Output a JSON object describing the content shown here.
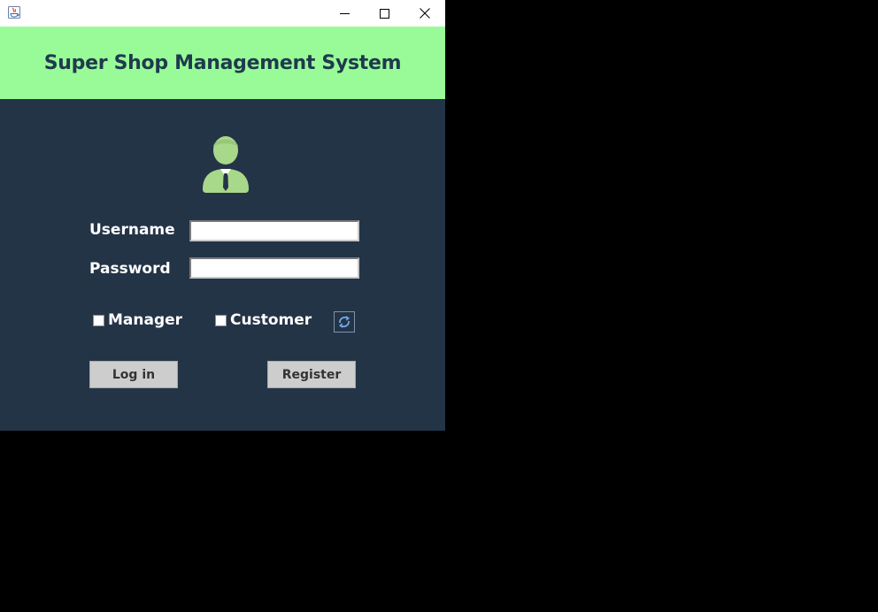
{
  "window": {
    "controls": {
      "minimize_icon": "minimize-icon",
      "maximize_icon": "maximize-icon",
      "close_icon": "close-icon"
    }
  },
  "header": {
    "title": "Super Shop Management System",
    "background": "#98fb98",
    "text_color": "#1f3a4d"
  },
  "form": {
    "background": "#243447",
    "avatar_icon": "user-avatar-icon",
    "username_label": "Username",
    "username_value": "",
    "password_label": "Password",
    "password_value": "",
    "manager_label": "Manager",
    "customer_label": "Customer",
    "refresh_icon": "refresh-icon",
    "login_label": "Log in",
    "register_label": "Register"
  }
}
